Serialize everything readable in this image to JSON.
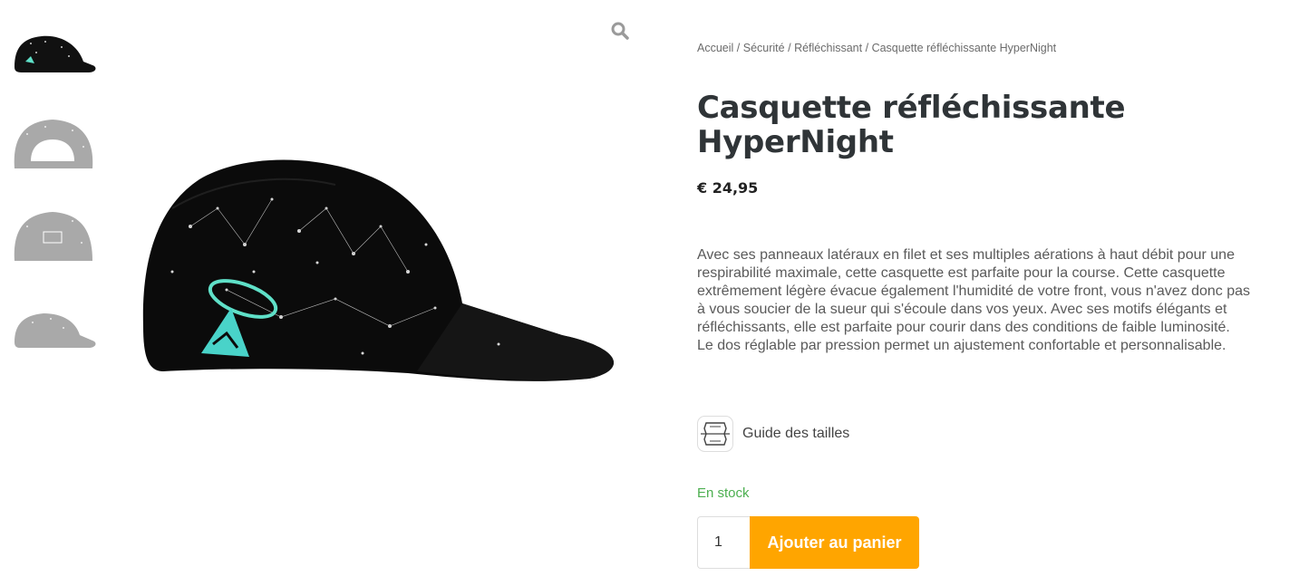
{
  "gallery": {
    "thumbnails": [
      {
        "name": "thumb-cap-side",
        "active": true
      },
      {
        "name": "thumb-cap-back",
        "active": false
      },
      {
        "name": "thumb-cap-front",
        "active": false
      },
      {
        "name": "thumb-cap-side-grey",
        "active": false
      }
    ],
    "zoom_icon": "search-icon"
  },
  "breadcrumb": {
    "items": [
      "Accueil",
      "Sécurité",
      "Réfléchissant",
      "Casquette réfléchissante HyperNight"
    ],
    "separator": "/"
  },
  "product": {
    "title": "Casquette réfléchissante HyperNight",
    "price": "€ 24,95",
    "description": "Avec ses panneaux latéraux en filet et ses multiples aérations à haut débit pour une respirabilité maximale, cette casquette est parfaite pour la course. Cette casquette extrêmement légère évacue également l'humidité de votre front, vous n'avez donc pas à vous soucier de la sueur qui s'écoule dans vos yeux. Avec ses motifs élégants et réfléchissants, elle est parfaite pour courir dans des conditions de faible luminosité. Le dos réglable par pression permet un ajustement confortable et personnalisable.",
    "size_guide_label": "Guide des tailles",
    "size_guide_icon": "size-chart-icon",
    "stock_status": "En stock",
    "quantity": "1",
    "add_to_cart_label": "Ajouter au panier"
  },
  "colors": {
    "accent": "#ffa500",
    "stock": "#4caf50",
    "title": "#2f3437"
  }
}
